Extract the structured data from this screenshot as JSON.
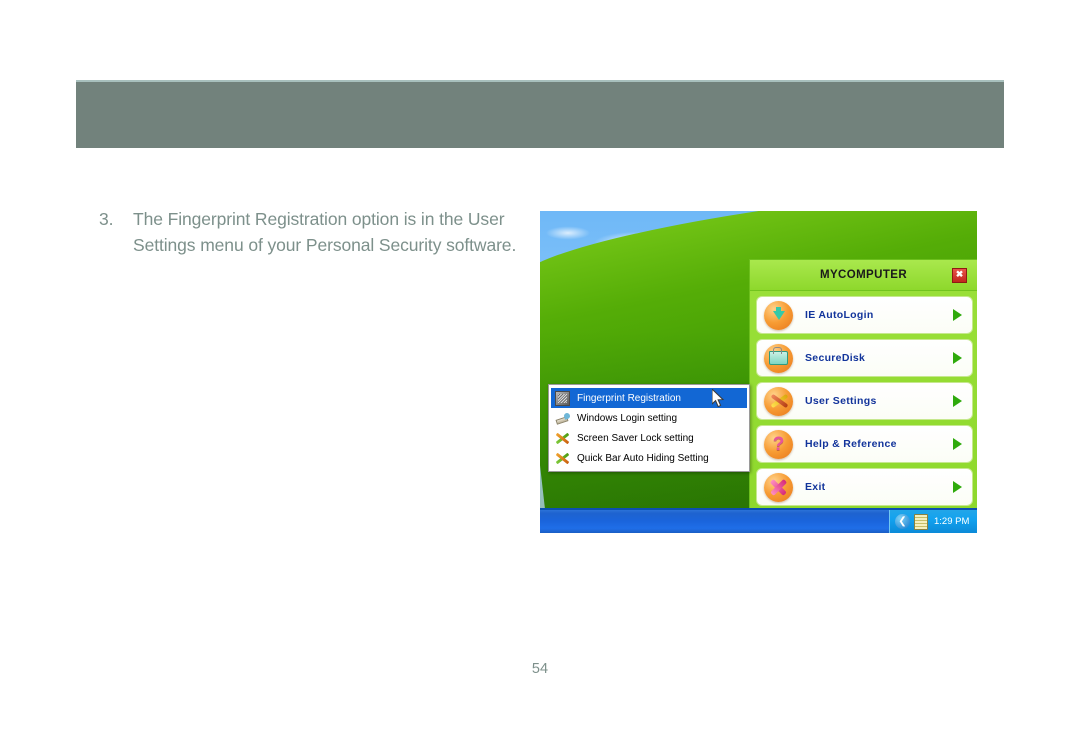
{
  "page": {
    "number": "54",
    "header_band_color": "#72827c",
    "body_text_color": "#7d908b"
  },
  "instruction": {
    "number": "3.",
    "text": "The Fingerprint Registration option is in the User Settings menu of your Personal Security software."
  },
  "screenshot": {
    "desktop": {
      "wallpaper_name": "bliss-wallpaper",
      "sky_color": "#8ecbfa",
      "hill_color": "#55ad07"
    },
    "taskbar": {
      "color": "#1a64dc",
      "chevron_icon": "show-hidden-icons-chevron",
      "chevron_glyph": "❮",
      "tray_icon": "tray-application-icon",
      "clock": "1:29 PM"
    },
    "panel": {
      "title": "MYCOMPUTER",
      "close_label": "✖",
      "header_color": "#8ed82c",
      "label_color": "#12349b",
      "items": [
        {
          "label": "IE AutoLogin",
          "icon": "download-arrow-icon"
        },
        {
          "label": "SecureDisk",
          "icon": "folder-lock-icon"
        },
        {
          "label": "User Settings",
          "icon": "tools-icon"
        },
        {
          "label": "Help & Reference",
          "icon": "question-mark-icon"
        },
        {
          "label": "Exit",
          "icon": "close-x-icon"
        }
      ]
    },
    "context_menu": {
      "highlight_color": "#1267d4",
      "items": [
        {
          "label": "Fingerprint Registration",
          "icon": "fingerprint-scanner-icon",
          "selected": true
        },
        {
          "label": "Windows Login setting",
          "icon": "pencil-icon",
          "selected": false
        },
        {
          "label": "Screen Saver Lock setting",
          "icon": "tools-icon",
          "selected": false
        },
        {
          "label": "Quick Bar Auto Hiding Setting",
          "icon": "tools-icon",
          "selected": false
        }
      ]
    },
    "cursor": {
      "icon": "mouse-arrow-cursor"
    }
  }
}
